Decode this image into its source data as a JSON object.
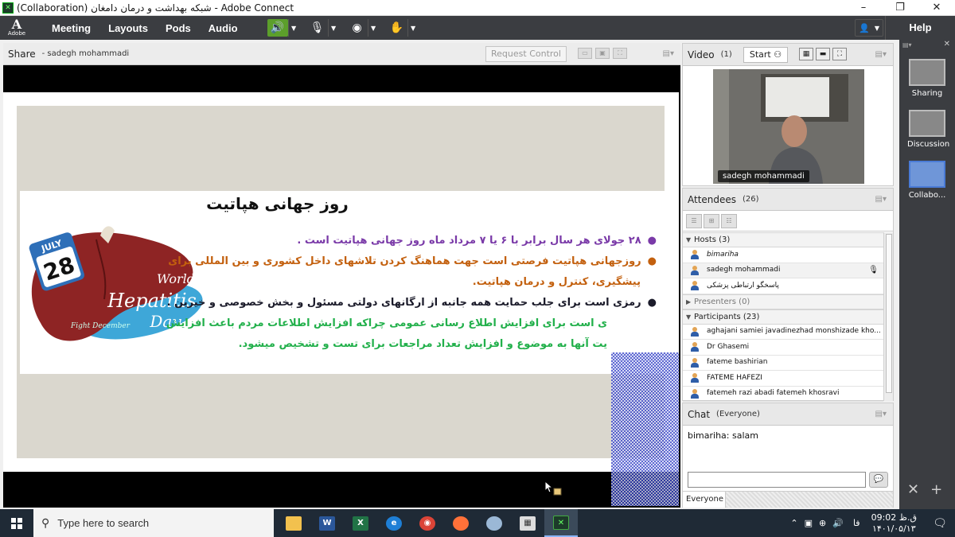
{
  "window": {
    "title": "(Collaboration) شبکه بهداشت و درمان دامغان - Adobe Connect",
    "controls": [
      "–",
      "❐",
      "✕"
    ]
  },
  "menubar": {
    "logo_word": "Adobe",
    "items": [
      "Meeting",
      "Layouts",
      "Pods",
      "Audio"
    ],
    "help": "Help"
  },
  "share": {
    "title": "Share",
    "presenter": "- sadegh mohammadi",
    "request_control": "Request Control",
    "slide": {
      "title": "روز جهانی هپاتیت",
      "bullets": [
        {
          "text": "۲۸ جولای هر سال برابر با ۶ یا ۷ مرداد ماه  روز جهانی هپاتیت است .",
          "color": "#7a3aa8"
        },
        {
          "text": "روزجهانی هپاتیت فرصتی است جهت هماهنگ کردن تلاشهای داخل کشوری و بین المللی برای",
          "color": "#c3600e"
        },
        {
          "text": "پیشگیری، کنترل و درمان هپاتیت.",
          "color": "#c3600e"
        },
        {
          "text": "رمزی است برای جلب حمایت همه جانبه از ارگانهای دولتی مسئول و بخش خصوصی و خیرین .",
          "color": "#1b1b2a"
        },
        {
          "text": "ی است برای افزایش اطلاع رسانی عمومی چراکه افزایش اطلاعات مردم باعث افزایش",
          "color": "#22b04b"
        },
        {
          "text": "یت آنها به موضوع و افزایش تعداد مراجعات برای تست و تشخیص میشود.",
          "color": "#22b04b"
        }
      ],
      "badge": {
        "month": "JULY",
        "day": "28",
        "line1": "World",
        "line2": "Hepatitis",
        "line3": "Day",
        "line4": "Fight December"
      }
    }
  },
  "video": {
    "title": "Video",
    "count": "(1)",
    "start": "Start",
    "feed_label": "sadegh mohammadi"
  },
  "attendees": {
    "title": "Attendees",
    "count": "(26)",
    "hosts_label": "Hosts (3)",
    "hosts": [
      "bimariha",
      "sadegh mohammadi",
      "پاسخگو ارتباطی پزشکی"
    ],
    "presenters_label": "Presenters (0)",
    "participants_label": "Participants (23)",
    "participants": [
      "aghajani samiei javadinezhad monshizade kho...",
      "Dr Ghasemi",
      "fateme bashirian",
      "FATEME HAFEZI",
      "fatemeh razi abadi fatemeh khosravi"
    ]
  },
  "chat": {
    "title": "Chat",
    "scope": "(Everyone)",
    "messages": [
      {
        "from": "bimariha",
        "text": "salam",
        "line": "bimariha: salam"
      }
    ],
    "recipient": "Everyone"
  },
  "layouts": {
    "items": [
      "Sharing",
      "Discussion",
      "Collabo..."
    ],
    "active": "Collabo..."
  },
  "taskbar": {
    "search_placeholder": "Type here to search",
    "lang": "فا",
    "time": "09:02 ق.ظ",
    "date": "۱۴۰۱/۰۵/۱۳"
  }
}
